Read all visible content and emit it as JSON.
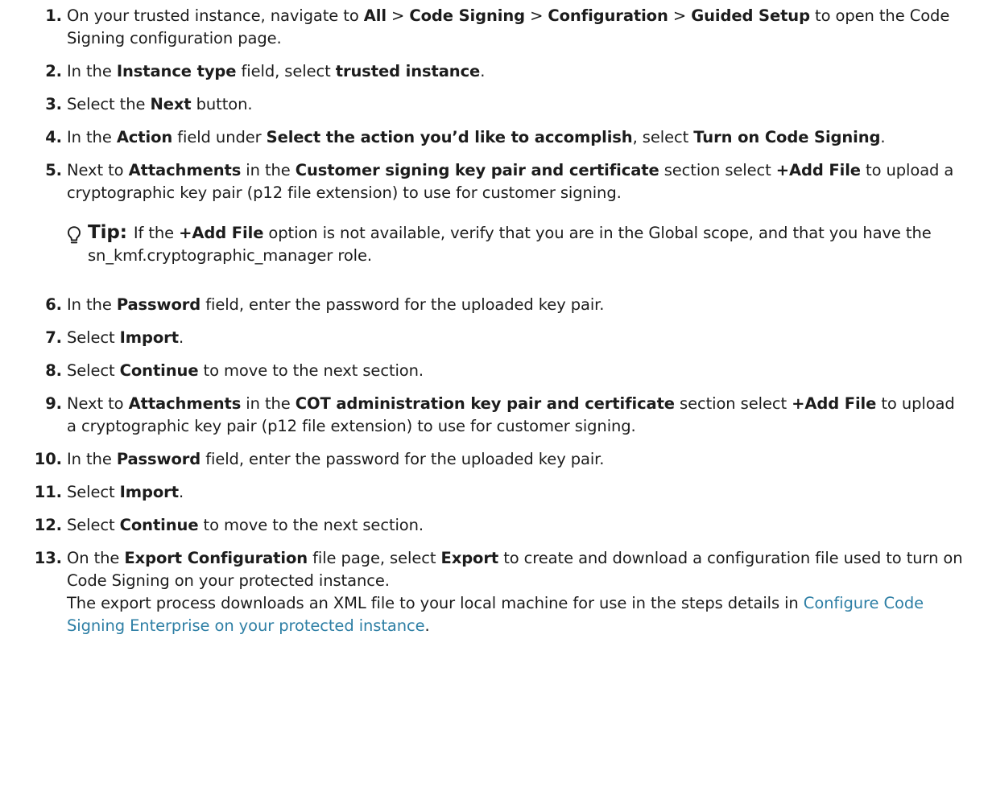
{
  "steps": [
    {
      "num": "1.",
      "parts": [
        "On your trusted instance, navigate to ",
        "All",
        " > ",
        "Code Signing",
        " > ",
        "Configuration",
        " > ",
        "Guided Setup",
        " to open the Code Signing configuration page."
      ]
    },
    {
      "num": "2.",
      "parts": [
        "In the ",
        "Instance type",
        " field, select ",
        "trusted instance",
        "."
      ]
    },
    {
      "num": "3.",
      "parts": [
        "Select the ",
        "Next",
        " button."
      ]
    },
    {
      "num": "4.",
      "parts": [
        "In the ",
        "Action",
        " field under ",
        "Select the action you’d like to accomplish",
        ", select ",
        "Turn on Code Signing",
        "."
      ]
    },
    {
      "num": "5.",
      "parts": [
        "Next to ",
        "Attachments",
        " in the ",
        "Customer signing key pair and certificate",
        " section select ",
        "+Add File",
        " to upload a cryptographic key pair (p12 file extension) to use for customer signing."
      ],
      "tip": {
        "label": "Tip:",
        "parts": [
          "If the ",
          "+Add File",
          " option is not available, verify that you are in the Global scope, and that you have the sn_kmf.cryptographic_manager role."
        ]
      }
    },
    {
      "num": "6.",
      "parts": [
        "In the ",
        "Password",
        " field, enter the password for the uploaded key pair."
      ]
    },
    {
      "num": "7.",
      "parts": [
        "Select ",
        "Import",
        "."
      ]
    },
    {
      "num": "8.",
      "parts": [
        "Select ",
        "Continue",
        " to move to the next section."
      ]
    },
    {
      "num": "9.",
      "parts": [
        "Next to ",
        "Attachments",
        " in the ",
        "COT administration key pair and certificate",
        " section select ",
        "+Add File",
        " to upload a cryptographic key pair (p12 file extension) to use for customer signing."
      ]
    },
    {
      "num": "10.",
      "parts": [
        "In the ",
        "Password",
        " field, enter the password for the uploaded key pair."
      ]
    },
    {
      "num": "11.",
      "parts": [
        "Select ",
        "Import",
        "."
      ]
    },
    {
      "num": "12.",
      "parts": [
        "Select ",
        "Continue",
        " to move to the next section."
      ]
    },
    {
      "num": "13.",
      "parts": [
        "On the ",
        "Export Configuration",
        " file page, select ",
        "Export",
        " to create and download a configuration file used to turn on Code Signing on your protected instance."
      ],
      "continuation": "The export process downloads an XML file to your local machine for use in the steps details in ",
      "link": "Configure Code Signing Enterprise on your protected instance",
      "after_link": "."
    }
  ],
  "link_color": "#2e7fa5",
  "tip_icon": "lightbulb-icon"
}
